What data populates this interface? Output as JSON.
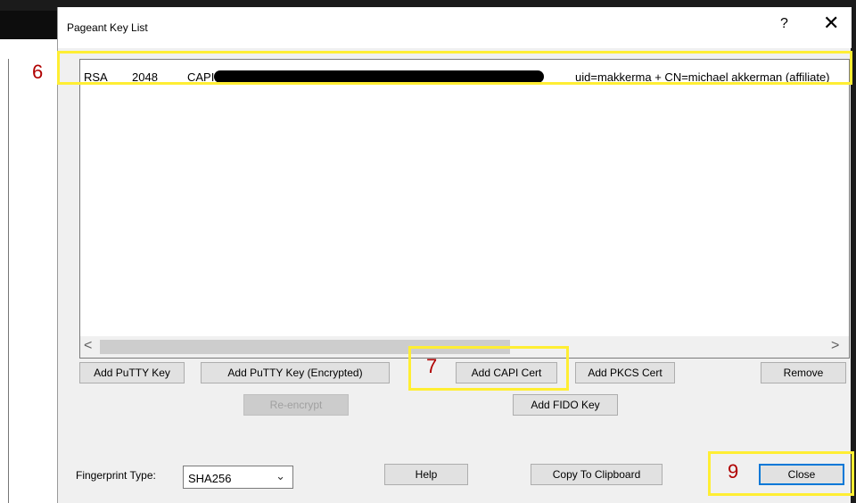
{
  "window": {
    "title": "Pageant Key List",
    "help_glyph": "?",
    "close_glyph": "✕"
  },
  "key_list": {
    "rows": [
      {
        "type": "RSA",
        "bits": "2048",
        "fingerprint_prefix": "CAPI:",
        "comment": "uid=makkerma + CN=michael akkerman (affiliate)"
      }
    ],
    "scroll_left_glyph": "<",
    "scroll_right_glyph": ">"
  },
  "buttons": {
    "add_putty_key": "Add PuTTY Key",
    "add_putty_key_encrypted": "Add PuTTY Key (Encrypted)",
    "add_capi_cert": "Add CAPI Cert",
    "add_pkcs_cert": "Add PKCS Cert",
    "remove": "Remove",
    "re_encrypt": "Re-encrypt",
    "add_fido_key": "Add FIDO Key",
    "help": "Help",
    "copy_to_clipboard": "Copy To Clipboard",
    "close": "Close"
  },
  "fingerprint": {
    "label": "Fingerprint Type:",
    "value": "SHA256"
  },
  "callouts": [
    "6",
    "7",
    "9"
  ],
  "colors": {
    "highlight": "#ffee33",
    "callout_number": "#b00000",
    "default_button_border": "#0078d7"
  }
}
